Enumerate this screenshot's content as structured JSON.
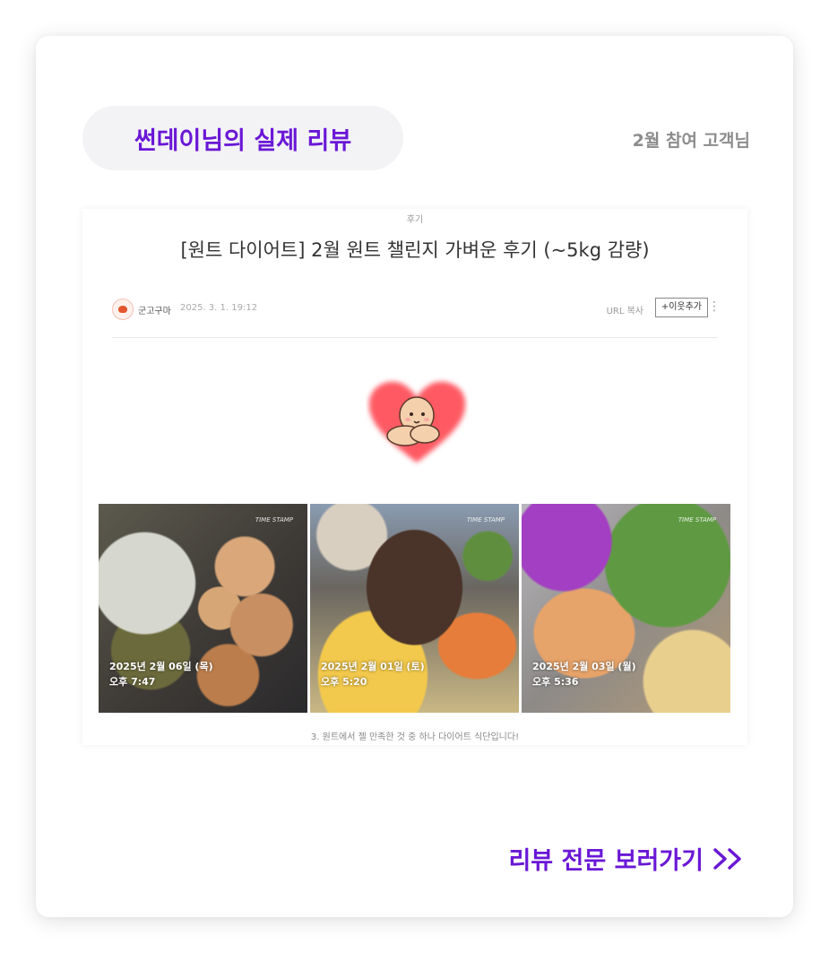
{
  "header": {
    "review_title": "썬데이님의 실제 리뷰",
    "participant": "2월 참여 고객님"
  },
  "post": {
    "category": "후기",
    "title": "[원트 다이어트] 2월 원트 챌린지 가벼운 후기 (~5kg 감량)",
    "author": "군고구마",
    "date": "2025. 3. 1. 19:12",
    "url_copy": "URL 복사",
    "add_neighbor": "+이웃추가",
    "more": "⋮",
    "photos": [
      {
        "date": "2025년 2월 06일 (목)",
        "time": "오후 7:47",
        "stamp": "TIME STAMP"
      },
      {
        "date": "2025년 2월 01일 (토)",
        "time": "오후 5:20",
        "stamp": "TIME STAMP"
      },
      {
        "date": "2025년 2월 03일 (월)",
        "time": "오후 5:36",
        "stamp": "TIME STAMP"
      }
    ],
    "caption": "3. 원트에서 젤 만족한 것 중 하나 다이어트 식단입니다!"
  },
  "cta": {
    "label": "리뷰 전문 보러가기",
    "icon": "double-chevron-right-icon"
  },
  "colors": {
    "accent": "#6a17d6",
    "pill_bg": "#f3f3f6",
    "muted": "#8c8c8c"
  }
}
